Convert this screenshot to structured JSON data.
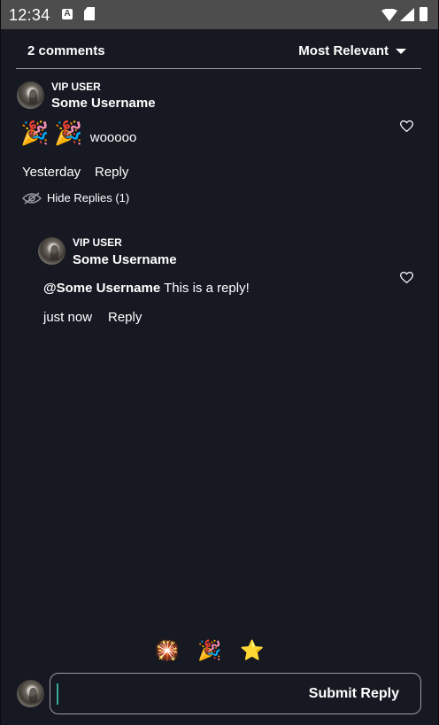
{
  "status": {
    "time": "12:34",
    "notification_letter": "A"
  },
  "header": {
    "comment_count": "2 comments",
    "sort_label": "Most Relevant"
  },
  "comment": {
    "badge": "VIP USER",
    "username": "Some Username",
    "emojis": [
      "🎉",
      "🎉"
    ],
    "text": "wooooo",
    "time": "Yesterday",
    "reply_label": "Reply",
    "hide_replies_label": "Hide Replies (1)"
  },
  "reply": {
    "badge": "VIP USER",
    "username": "Some Username",
    "mention": "@Some Username",
    "text": " This is a reply!",
    "time": "just now",
    "reply_label": "Reply"
  },
  "emoji_bar": [
    "🎇",
    "🎉",
    "⭐"
  ],
  "composer": {
    "placeholder": "",
    "submit_label": "Submit Reply"
  },
  "colors": {
    "background": "#161822",
    "statusbar": "#4d4d4d",
    "divider": "#9a9ca6",
    "cursor": "#3aa99a",
    "star": "#f5c518"
  }
}
